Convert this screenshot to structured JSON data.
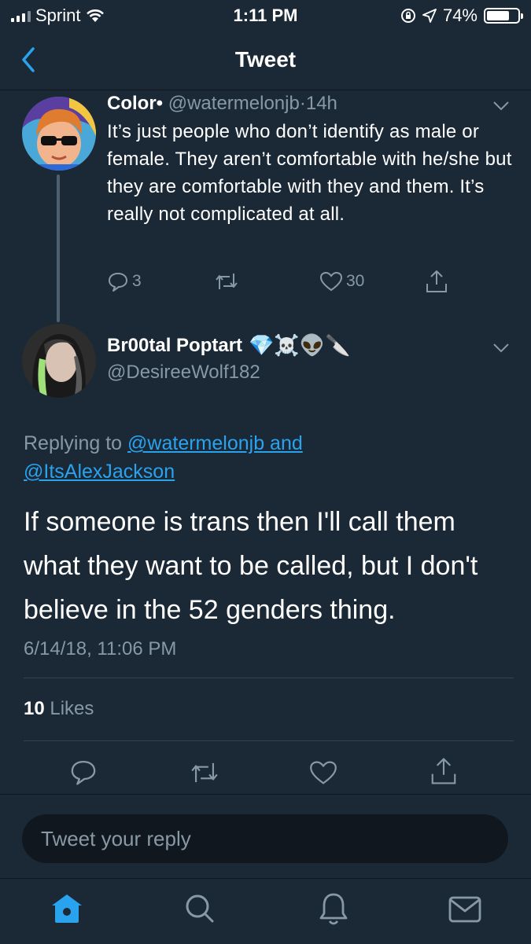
{
  "status_bar": {
    "carrier": "Sprint",
    "time": "1:11 PM",
    "battery": "74%",
    "battery_level": 0.74
  },
  "nav": {
    "title": "Tweet"
  },
  "parent_tweet": {
    "display_name": "Color•",
    "handle": "@watermelonjb",
    "separator": "·",
    "age": "14h",
    "text": "It’s just people who don’t identify as male or female. They aren’t comfortable with he/she but they are comfortable with they and them. It’s really not complicated at all.",
    "replies": "3",
    "likes": "30"
  },
  "main_tweet": {
    "display_name": "Br00tal Poptart",
    "name_emoji": "💎☠️👽🔪",
    "handle": "@DesireeWolf182",
    "replying_prefix": "Replying to",
    "replying_to_1": "@watermelonjb and",
    "replying_to_2": "@ItsAlexJackson",
    "text": "If someone is trans then I'll call them what they want to be called, but I don't believe in the 52 genders thing.",
    "timestamp": "6/14/18, 11:06 PM",
    "likes_count": "10",
    "likes_label": "Likes"
  },
  "composer": {
    "placeholder": "Tweet your reply"
  },
  "colors": {
    "accent": "#2aa3ef",
    "background": "#1b2836",
    "muted": "#8899a6"
  }
}
